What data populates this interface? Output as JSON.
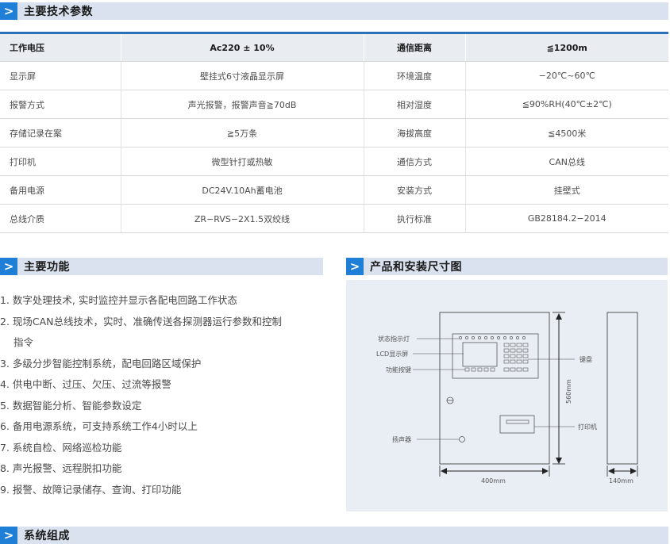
{
  "sections": {
    "params_title": "主要技术参数",
    "functions_title": "主要功能",
    "diagram_title": "产品和安装尺寸图",
    "system_title": "系统组成"
  },
  "specs": {
    "header": [
      "工作电压",
      "Ac220 ± 10%",
      "通信距离",
      "≦1200m"
    ],
    "rows": [
      [
        "显示屏",
        "壁挂式6寸液晶显示屏",
        "环境温度",
        "−20℃~60℃"
      ],
      [
        "报警方式",
        "声光报警，报警声音≧70dB",
        "相对湿度",
        "≦90%RH(40℃±2℃)"
      ],
      [
        "存储记录在案",
        "≧5万条",
        "海拔高度",
        "≦4500米"
      ],
      [
        "打印机",
        "微型针打或热敏",
        "通信方式",
        "CAN总线"
      ],
      [
        "备用电源",
        "DC24V.10Ah蓄电池",
        "安装方式",
        "挂壁式"
      ],
      [
        "总线介质",
        "ZR−RVS−2X1.5双绞线",
        "执行标准",
        "GB28184.2−2014"
      ]
    ]
  },
  "functions": [
    "1. 数字处理技术, 实时监控并显示各配电回路工作状态",
    "2. 现场CAN总线技术，实时、准确传送各探测器运行参数和控制",
    "指令",
    "3. 多级分步智能控制系统，配电回路区域保护",
    "4. 供电中断、过压、欠压、过流等报警",
    "5. 数据智能分析、智能参数设定",
    "6. 备用电源系统，可支持系统工作4小时以上",
    "7. 系统自检、网络巡检功能",
    "8. 声光报警、远程脱扣功能",
    "9. 报警、故障记录储存、查询、打印功能"
  ],
  "diagram": {
    "label_status_light": "状态指示灯",
    "label_lcd": "LCD显示屏",
    "label_func_keys": "功能按键",
    "label_keypad": "键盘",
    "label_printer": "打印机",
    "label_speaker": "扬声器",
    "dim_height": "560mm",
    "dim_width": "400mm",
    "dim_depth": "140mm"
  },
  "colors": {
    "accent": "#1f7fd6",
    "bar": "#d9e2ee",
    "table_rule": "#2b70b8",
    "diagram_bg": "#e9eef5"
  }
}
